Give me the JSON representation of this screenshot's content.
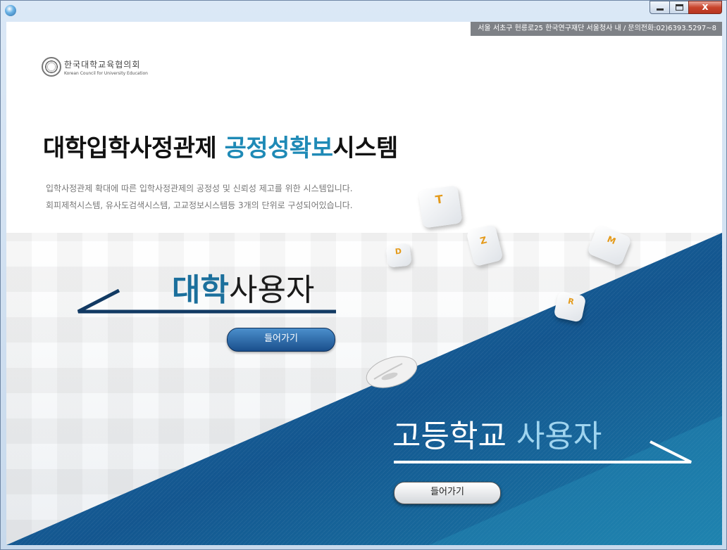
{
  "window": {
    "controls": [
      "minimize",
      "maximize",
      "close"
    ],
    "close_glyph": "x"
  },
  "header": {
    "info_line": "서울 서초구 헌릉로25 한국연구재단 서울청사 내  /  문의전화:02)6393.5297~8"
  },
  "logo": {
    "korean_name": "한국대학교육협의회",
    "english_name": "Korean Council for University Education"
  },
  "title": {
    "part1": "대학입학사정관제 ",
    "part2": "공정성확보",
    "part3": "시스템"
  },
  "description": {
    "line1": "입학사정관제 확대에 따른 입학사정관제의 공정성 및 신뢰성 제고를 위한 시스템입니다.",
    "line2": "회피제척시스템, 유사도검색시스템, 고교정보시스템등 3개의 단위로 구성되어있습니다."
  },
  "keys": [
    "T",
    "D",
    "Z",
    "M",
    "R"
  ],
  "university": {
    "heading_bold": "대학",
    "heading_rest": "사용자",
    "enter_label": "들어가기"
  },
  "highschool": {
    "heading_bold": "고등학교",
    "heading_rest": " 사용자",
    "enter_label": "들어가기"
  },
  "colors": {
    "accent_blue": "#1f8ab6",
    "panel_blue": "#0f4f86",
    "button_blue": "#1a4f8c",
    "key_orange": "#e49a1a"
  }
}
